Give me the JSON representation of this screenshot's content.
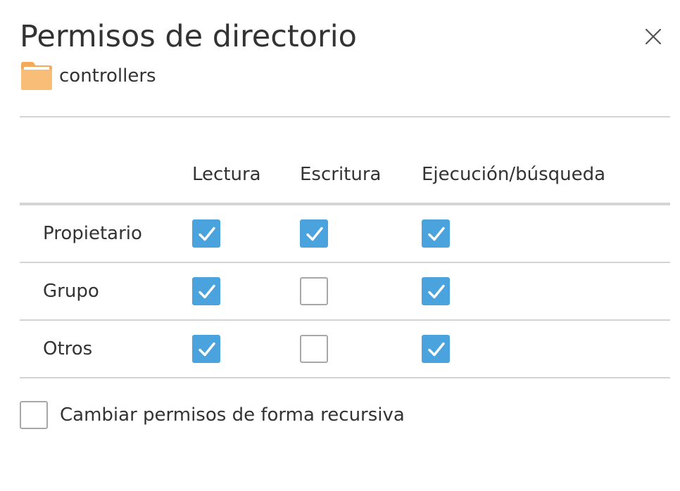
{
  "dialog": {
    "title": "Permisos de directorio",
    "close_icon": "close-icon"
  },
  "folder": {
    "icon": "folder-icon",
    "icon_color": "#f5a95a",
    "name": "controllers"
  },
  "columns": [
    "Lectura",
    "Escritura",
    "Ejecución/búsqueda"
  ],
  "rows": [
    {
      "label": "Propietario",
      "read": true,
      "write": true,
      "execute": true
    },
    {
      "label": "Grupo",
      "read": true,
      "write": false,
      "execute": true
    },
    {
      "label": "Otros",
      "read": true,
      "write": false,
      "execute": true
    }
  ],
  "recursive": {
    "label": "Cambiar permisos de forma recursiva",
    "checked": false
  },
  "colors": {
    "checkbox_checked": "#4aa3dc",
    "checkbox_border": "#a8a8a8",
    "divider": "#d4d4d4",
    "text": "#333333"
  }
}
